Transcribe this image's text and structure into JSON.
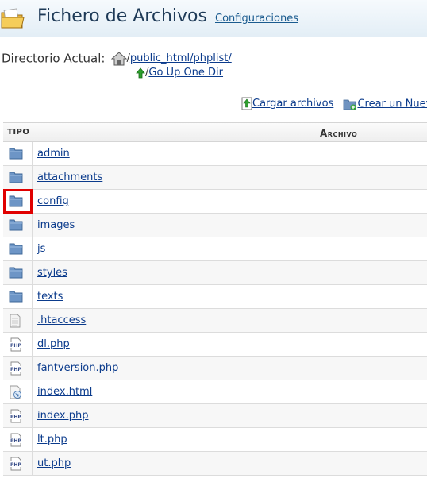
{
  "header": {
    "title": "Fichero de Archivos",
    "config_link": "Configuraciones"
  },
  "directory": {
    "label": "Directorio Actual:",
    "slash": "/",
    "path": "public_html/phplist/",
    "up_link": "Go Up One Dir"
  },
  "actions": {
    "upload": "Cargar archivos",
    "create": "Crear un Nuevo"
  },
  "table": {
    "col_tipo": "TIPO",
    "col_archivo": "Archivo",
    "rows": [
      {
        "name": "admin",
        "type": "folder"
      },
      {
        "name": "attachments",
        "type": "folder"
      },
      {
        "name": "config",
        "type": "folder",
        "highlighted": true
      },
      {
        "name": "images",
        "type": "folder"
      },
      {
        "name": "js",
        "type": "folder"
      },
      {
        "name": "styles",
        "type": "folder"
      },
      {
        "name": "texts",
        "type": "folder"
      },
      {
        "name": ".htaccess",
        "type": "text"
      },
      {
        "name": "dl.php",
        "type": "php"
      },
      {
        "name": "fantversion.php",
        "type": "php"
      },
      {
        "name": "index.html",
        "type": "html"
      },
      {
        "name": "index.php",
        "type": "php"
      },
      {
        "name": "lt.php",
        "type": "php"
      },
      {
        "name": "ut.php",
        "type": "php"
      }
    ]
  },
  "colors": {
    "link": "#0b3b8c",
    "highlight": "#e00000",
    "folder": "#5b86b8"
  }
}
